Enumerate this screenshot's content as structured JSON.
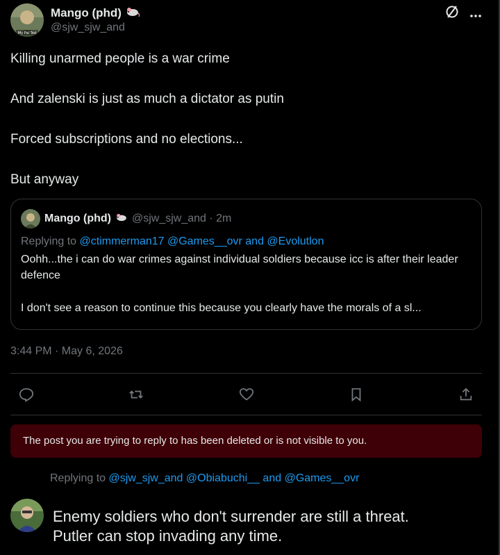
{
  "author": {
    "name": "Mango (phd)",
    "handle": "@sjw_sjw_and",
    "badge_emoji": "rat-emoji",
    "avatar_caption": "My Pal Ted"
  },
  "top_actions": {
    "grok_icon": "slash-circle-icon",
    "more_icon": "more-icon"
  },
  "post": {
    "paragraphs": [
      "Killing unarmed people is a war crime",
      "And zalenski is just as much a dictator as putin",
      "Forced subscriptions and no elections...",
      "But anyway"
    ]
  },
  "quote": {
    "name": "Mango (phd)",
    "handle_time": "@sjw_sjw_and · 2m",
    "replying_prefix": "Replying to",
    "replying_to": "@ctimmerman17 @Games__ovr and @Evolutlon",
    "text1": "Oohh...the i can do war crimes against individual soldiers because icc is after their leader defence",
    "text2": "I don't see a reason to continue this because you clearly have the morals of a sl..."
  },
  "timestamp": "3:44 PM · May 6, 2026",
  "actions": [
    "reply-icon",
    "repost-icon",
    "like-icon",
    "bookmark-icon",
    "share-icon"
  ],
  "notice": "The post you are trying to reply to has been deleted or is not visible to you.",
  "reply": {
    "prefix": "Replying to",
    "mentions": "@sjw_sjw_and @Obiabuchi__ and @Games__ovr",
    "text_line1": "Enemy soldiers who don't surrender are still a threat.",
    "text_line2": "Putler can stop invading any time."
  },
  "colors": {
    "background": "#000000",
    "text": "#e7e9ea",
    "muted": "#71767b",
    "link": "#1d9bf0",
    "notice_bg": "#3e0006",
    "border": "#2f3336"
  }
}
